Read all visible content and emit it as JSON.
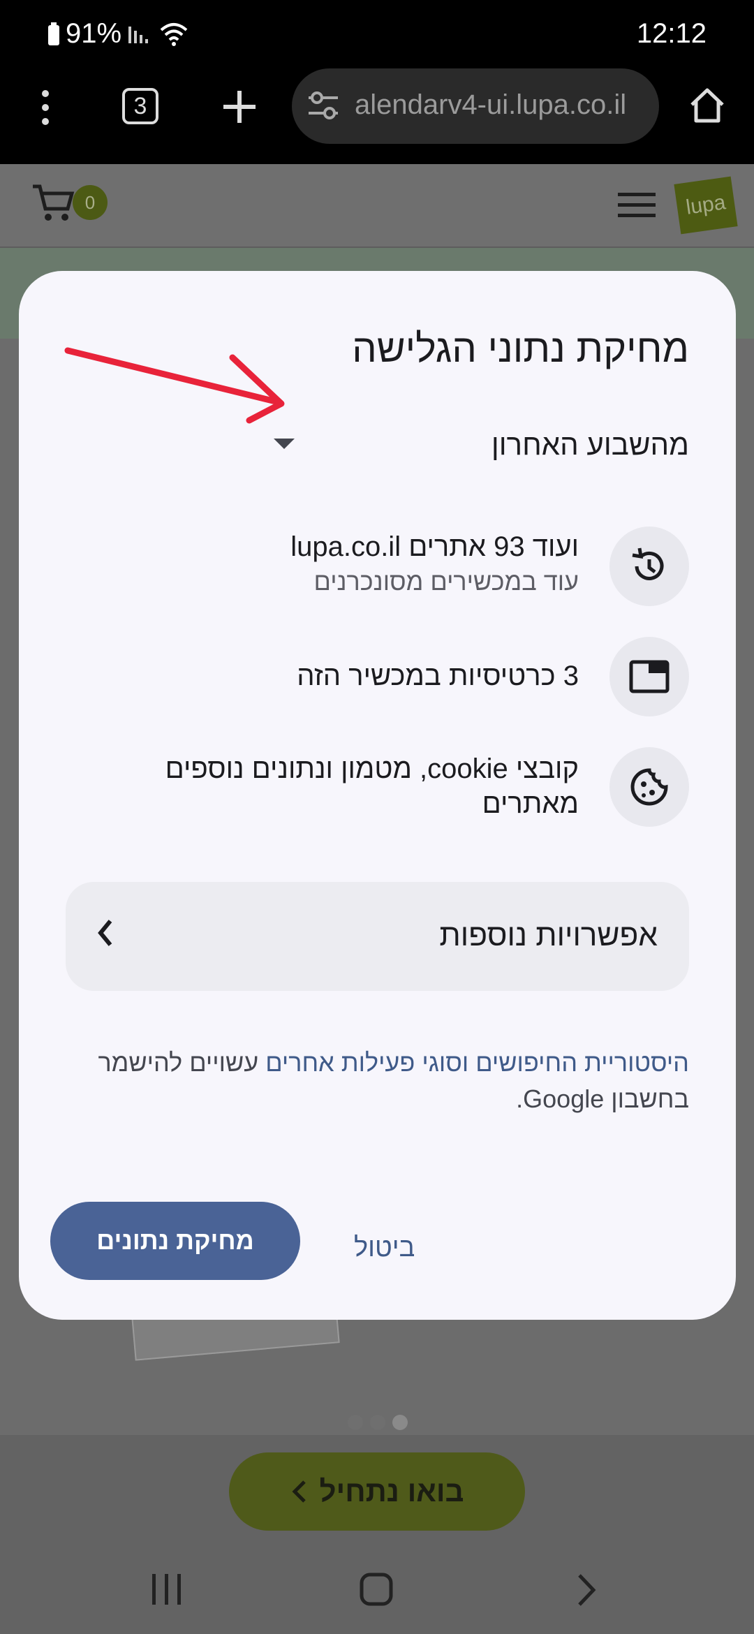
{
  "status_bar": {
    "battery": "91%",
    "time": "12:12",
    "battery_icon": "battery-icon",
    "signal_icon": "signal-icon",
    "wifi_icon": "wifi-icon"
  },
  "browser": {
    "tab_count": "3",
    "url": "alendarv4-ui.lupa.co.il",
    "menu_icon": "more-vert-icon",
    "new_tab_icon": "plus-icon",
    "site_settings_icon": "tune-icon",
    "home_icon": "home-icon"
  },
  "site": {
    "cart_count": "0",
    "logo_text": "lupa",
    "start_button": "בואו נתחיל"
  },
  "dialog": {
    "title": "מחיקת נתוני הגלישה",
    "time_range": "מהשבוע האחרון",
    "rows": [
      {
        "icon": "history-icon",
        "text": "ועוד 93 אתרים lupa.co.il",
        "sub": "עוד במכשירים מסונכרנים"
      },
      {
        "icon": "tabs-icon",
        "text": "3 כרטיסיות במכשיר הזה",
        "sub": ""
      },
      {
        "icon": "cookie-icon",
        "text": "קובצי cookie, מטמון ונתונים נוספים מאתרים",
        "sub": ""
      }
    ],
    "more_options": "אפשרויות נוספות",
    "info_link": "היסטוריית החיפושים וסוגי פעילות אחרים",
    "info_rest": "עשויים להישמר בחשבון Google.",
    "cancel": "ביטול",
    "delete": "מחיקת נתונים"
  },
  "colors": {
    "primary": "#4a6396",
    "annotation_arrow": "#e8233a",
    "dialog_bg": "#f7f6fc"
  }
}
